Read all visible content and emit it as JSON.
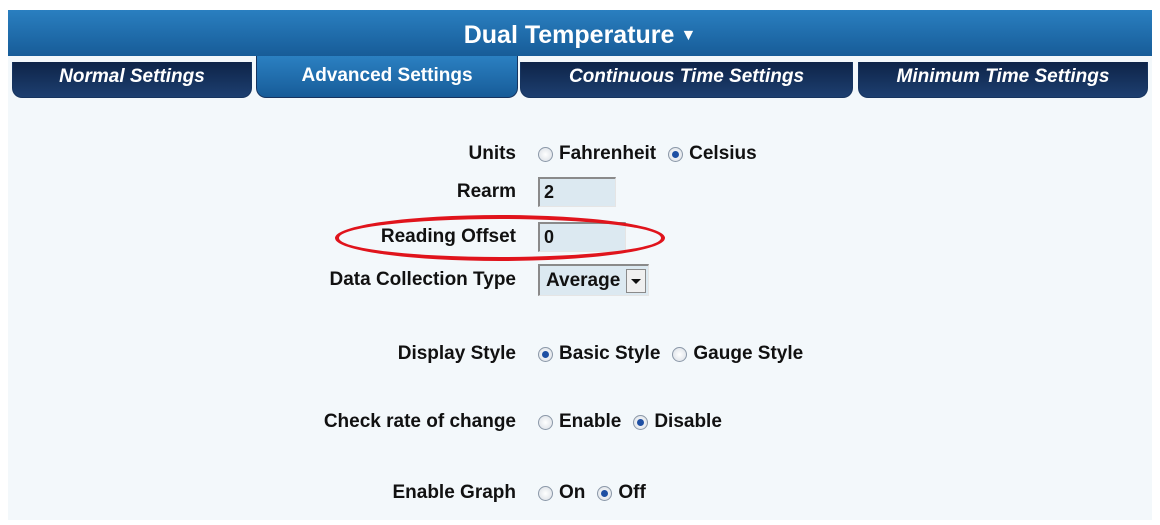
{
  "header": {
    "title": "Dual Temperature",
    "arrow": "▼"
  },
  "tabs": [
    {
      "label": "Normal Settings",
      "active": false
    },
    {
      "label": "Advanced Settings",
      "active": true
    },
    {
      "label": "Continuous Time Settings",
      "active": false
    },
    {
      "label": "Minimum Time Settings",
      "active": false
    }
  ],
  "form": {
    "units": {
      "label": "Units",
      "options": [
        "Fahrenheit",
        "Celsius"
      ],
      "selected": "Celsius"
    },
    "rearm": {
      "label": "Rearm",
      "value": "2"
    },
    "reading_offset": {
      "label": "Reading Offset",
      "value": "0"
    },
    "data_collection_type": {
      "label": "Data Collection Type",
      "value": "Average"
    },
    "display_style": {
      "label": "Display Style",
      "options": [
        "Basic Style",
        "Gauge Style"
      ],
      "selected": "Basic Style"
    },
    "check_rate_of_change": {
      "label": "Check rate of change",
      "options": [
        "Enable",
        "Disable"
      ],
      "selected": "Disable"
    },
    "enable_graph": {
      "label": "Enable Graph",
      "options": [
        "On",
        "Off"
      ],
      "selected": "Off"
    }
  },
  "colors": {
    "header_blue": "#1e6bb0",
    "tab_dark": "#0e2448",
    "highlight": "#e0141c",
    "field_bg": "#dce9f1"
  }
}
